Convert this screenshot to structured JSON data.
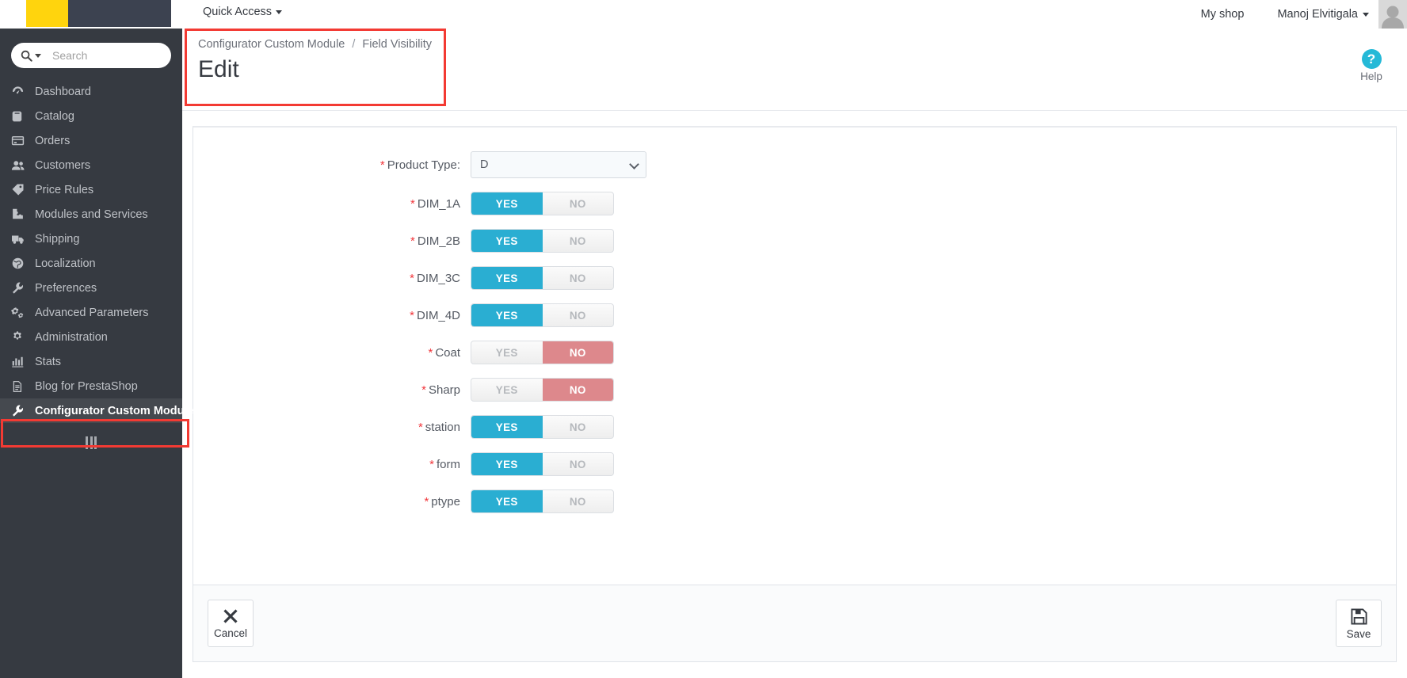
{
  "topbar": {
    "quick_access": "Quick Access",
    "my_shop": "My shop",
    "user_name": "Manoj Elvitigala",
    "logo_colors": {
      "yellow": "#ffd40d",
      "dark": "#3c4250"
    }
  },
  "sidebar": {
    "search_placeholder": "Search",
    "items": [
      {
        "label": "Dashboard",
        "icon": "dashboard-icon",
        "active": false
      },
      {
        "label": "Catalog",
        "icon": "book-icon",
        "active": false
      },
      {
        "label": "Orders",
        "icon": "credit-card-icon",
        "active": false
      },
      {
        "label": "Customers",
        "icon": "people-icon",
        "active": false
      },
      {
        "label": "Price Rules",
        "icon": "tag-icon",
        "active": false
      },
      {
        "label": "Modules and Services",
        "icon": "puzzle-icon",
        "active": false
      },
      {
        "label": "Shipping",
        "icon": "truck-icon",
        "active": false
      },
      {
        "label": "Localization",
        "icon": "globe-icon",
        "active": false
      },
      {
        "label": "Preferences",
        "icon": "wrench-icon",
        "active": false
      },
      {
        "label": "Advanced Parameters",
        "icon": "gears-icon",
        "active": false
      },
      {
        "label": "Administration",
        "icon": "gear-icon",
        "active": false
      },
      {
        "label": "Stats",
        "icon": "bar-chart-icon",
        "active": false
      },
      {
        "label": "Blog for PrestaShop",
        "icon": "document-icon",
        "active": false
      },
      {
        "label": "Configurator Custom Module",
        "icon": "wrench-icon",
        "active": true
      }
    ]
  },
  "page": {
    "breadcrumb": {
      "parent": "Configurator Custom Module",
      "separator": "/",
      "current": "Field Visibility"
    },
    "title": "Edit",
    "help_label": "Help",
    "help_glyph": "?",
    "annotation_color": "#f33a33"
  },
  "form": {
    "product_type": {
      "label": "Product Type:",
      "required": true,
      "value": "D",
      "options": [
        "D"
      ]
    },
    "toggle_yes_label": "YES",
    "toggle_no_label": "NO",
    "toggle_colors": {
      "yes": "#2aaed2",
      "no": "#dd888c",
      "off": "#b6b9bd"
    },
    "toggles": [
      {
        "label": "DIM_1A",
        "required": true,
        "value": "YES"
      },
      {
        "label": "DIM_2B",
        "required": true,
        "value": "YES"
      },
      {
        "label": "DIM_3C",
        "required": true,
        "value": "YES"
      },
      {
        "label": "DIM_4D",
        "required": true,
        "value": "YES"
      },
      {
        "label": "Coat",
        "required": true,
        "value": "NO"
      },
      {
        "label": "Sharp",
        "required": true,
        "value": "NO"
      },
      {
        "label": "station",
        "required": true,
        "value": "YES"
      },
      {
        "label": "form",
        "required": true,
        "value": "YES"
      },
      {
        "label": "ptype",
        "required": true,
        "value": "YES"
      }
    ]
  },
  "footer": {
    "cancel_label": "Cancel",
    "save_label": "Save"
  }
}
